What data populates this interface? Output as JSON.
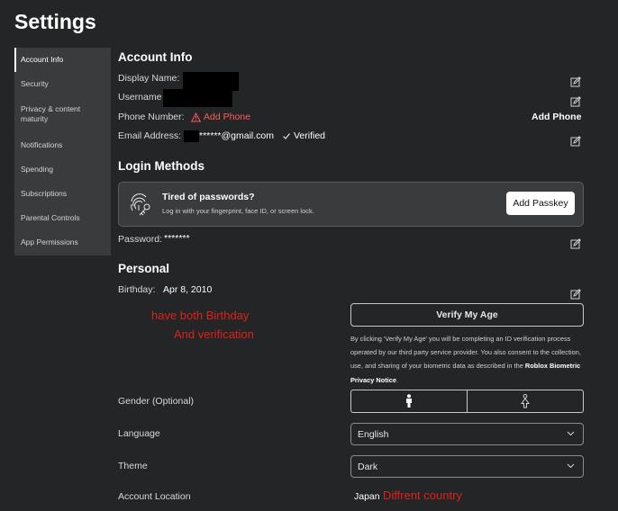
{
  "page": {
    "title": "Settings"
  },
  "sidebar": {
    "items": [
      {
        "label": "Account Info"
      },
      {
        "label": "Security"
      },
      {
        "label": "Privacy & content maturity"
      },
      {
        "label": "Notifications"
      },
      {
        "label": "Spending"
      },
      {
        "label": "Subscriptions"
      },
      {
        "label": "Parental Controls"
      },
      {
        "label": "App Permissions"
      }
    ]
  },
  "account_info": {
    "title": "Account Info",
    "display_name_label": "Display Name:",
    "username_label": "Username",
    "phone_label": "Phone Number:",
    "add_phone_warning": "Add Phone",
    "add_phone_button": "Add Phone",
    "email_label": "Email Address:",
    "email_value": "******@gmail.com",
    "verified": "Verified"
  },
  "login_methods": {
    "title": "Login Methods",
    "passkey_title": "Tired of passwords?",
    "passkey_subtitle": "Log in with your fingerprint, face ID, or screen lock.",
    "passkey_button": "Add Passkey",
    "password_label": "Password:",
    "password_value": "*******"
  },
  "personal": {
    "title": "Personal",
    "birthday_label": "Birthday:",
    "birthday_value": "Apr 8, 2010",
    "verify_button": "Verify My Age",
    "disclaimer_text": "By clicking 'Verify My Age' you will be completing an ID verification process operated by our third party service provider. You also consent to the collection, use, and sharing of your biometric data as described in the ",
    "disclaimer_link": "Roblox Biometric Privacy Notice",
    "disclaimer_end": ".",
    "gender_label": "Gender (Optional)",
    "language_label": "Language",
    "language_value": "English",
    "theme_label": "Theme",
    "theme_value": "Dark",
    "location_label": "Account Location",
    "location_value": "Japan"
  },
  "annotations": {
    "note_line1": "have both Birthday",
    "note_line2": "And verification",
    "country_note": "Diffrent country",
    "color": "#e0201a"
  },
  "icons": {
    "edit": "edit-icon",
    "warning": "warning-icon",
    "check": "check-icon",
    "fingerprint": "fingerprint-key-icon",
    "gender_male": "male-icon",
    "gender_female": "female-icon",
    "chevron": "chevron-down-icon"
  }
}
